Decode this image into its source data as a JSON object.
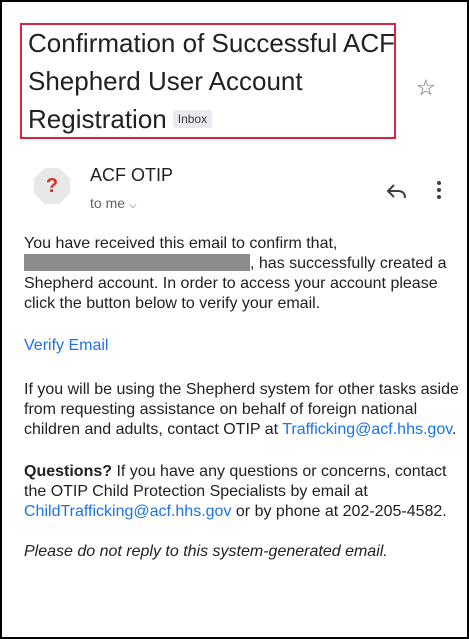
{
  "email": {
    "subject": "Confirmation of Successful ACF Shepherd User Account Registration",
    "label": "Inbox",
    "sender": "ACF OTIP",
    "avatar_letter": "?",
    "recipient": "to me",
    "body": {
      "p1_start": "You have received this email to confirm that,",
      "p1_end": ", has successfully created a Shepherd account. In order to access your account please click the button below to verify your email.",
      "verify_link": "Verify Email",
      "p2_text": "If you will be using the Shepherd system for other tasks aside from requesting assistance on behalf of foreign national children and adults, contact OTIP at ",
      "p2_email": "Trafficking@acf.hhs.gov",
      "p2_end": ".",
      "p3_bold": "Questions?",
      "p3_text": " If you have any questions or concerns, contact the OTIP Child Protection Specialists by email at ",
      "p3_email": "ChildTrafficking@acf.hhs.gov",
      "p3_text2": " or by phone at 202-205-4582.",
      "p4": "Please do not reply to this system-generated email."
    }
  },
  "icons": {
    "star": "star-icon",
    "reply": "reply-icon",
    "more": "more-vert-icon"
  },
  "colors": {
    "highlight_border": "#d7263d",
    "link": "#1a73e8",
    "redaction": "#8b8b8b"
  }
}
